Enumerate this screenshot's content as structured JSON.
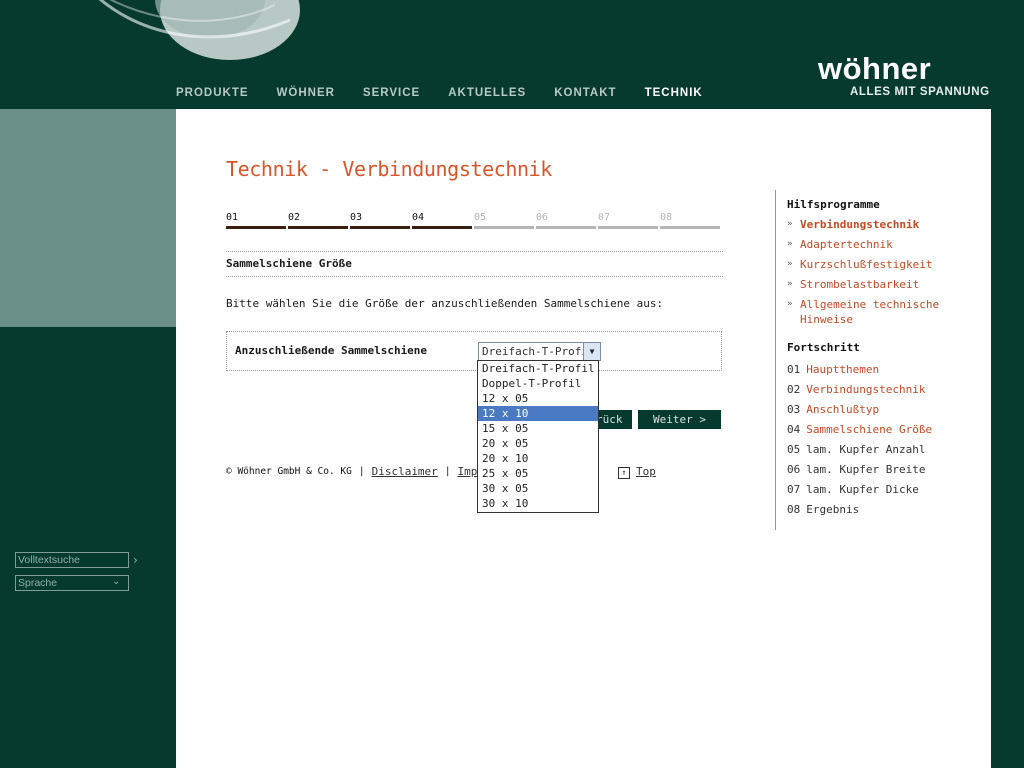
{
  "header": {
    "nav": [
      "PRODUKTE",
      "WÖHNER",
      "SERVICE",
      "AKTUELLES",
      "KONTAKT",
      "TECHNIK"
    ],
    "logo_name": "wöhner",
    "logo_claim": "ALLES MIT SPANNUNG"
  },
  "left": {
    "search_placeholder": "Volltextsuche",
    "language": "Sprache"
  },
  "main": {
    "title": "Technik - Verbindungstechnik",
    "steps_done": [
      "01",
      "02",
      "03",
      "04"
    ],
    "steps_todo": [
      "05",
      "06",
      "07",
      "08"
    ],
    "section_title": "Sammelschiene Größe",
    "instruction": "Bitte wählen Sie die Größe der anzuschließenden Sammelschiene aus:",
    "field_label": "Anzuschließende Sammelschiene",
    "select_value": "Dreifach-T-Profil",
    "back_label": "< Zurück",
    "next_label": "Weiter >",
    "footer_copyright": "© Wöhner GmbH & Co. KG",
    "footer_disclaimer": "Disclaimer",
    "footer_impressum": "Impressum",
    "footer_top": "Top"
  },
  "dropdown": {
    "options": [
      "Dreifach-T-Profil",
      "Doppel-T-Profil",
      "12 x 05",
      "12 x 10",
      "15 x 05",
      "20 x 05",
      "20 x 10",
      "25 x 05",
      "30 x 05",
      "30 x 10"
    ],
    "selected": "12 x 10"
  },
  "sidebar": {
    "hilfs_title": "Hilfsprogramme",
    "hilfs_items": [
      "Verbindungstechnik",
      "Adaptertechnik",
      "Kurzschlußfestigkeit",
      "Strombelastbarkeit",
      "Allgemeine technische Hinweise"
    ],
    "fort_title": "Fortschritt",
    "progress": [
      {
        "num": "01",
        "label": "Hauptthemen"
      },
      {
        "num": "02",
        "label": "Verbindungstechnik"
      },
      {
        "num": "03",
        "label": "Anschlußtyp"
      },
      {
        "num": "04",
        "label": "Sammelschiene Größe"
      },
      {
        "num": "05",
        "label": "lam. Kupfer Anzahl"
      },
      {
        "num": "06",
        "label": "lam. Kupfer Breite"
      },
      {
        "num": "07",
        "label": "lam. Kupfer Dicke"
      },
      {
        "num": "08",
        "label": "Ergebnis"
      }
    ]
  },
  "colors": {
    "dark_green": "#063a2e",
    "accent_orange": "#d9552a",
    "panel_grey_green": "#6b8f89",
    "highlight_blue": "#4a7ac3"
  }
}
